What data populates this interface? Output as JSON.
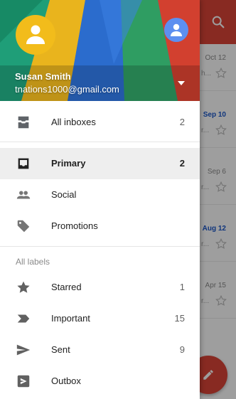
{
  "account": {
    "name": "Susan Smith",
    "email": "tnations1000@gmail.com"
  },
  "drawer": {
    "all_inboxes": {
      "label": "All inboxes",
      "count": "2"
    },
    "categories": [
      {
        "label": "Primary",
        "count": "2",
        "icon": "inbox-icon",
        "selected": true
      },
      {
        "label": "Social",
        "count": "",
        "icon": "people-icon"
      },
      {
        "label": "Promotions",
        "count": "",
        "icon": "tag-icon"
      }
    ],
    "labels_header": "All labels",
    "labels": [
      {
        "label": "Starred",
        "count": "1",
        "icon": "star-icon"
      },
      {
        "label": "Important",
        "count": "15",
        "icon": "important-icon"
      },
      {
        "label": "Sent",
        "count": "9",
        "icon": "send-icon"
      },
      {
        "label": "Outbox",
        "count": "",
        "icon": "outbox-icon"
      }
    ]
  },
  "background_list": {
    "rows": [
      {
        "date": "Oct 12",
        "unread": false,
        "snippet": "h..."
      },
      {
        "date": "Sep 10",
        "unread": true,
        "snippet": "r..."
      },
      {
        "date": "Sep 6",
        "unread": false,
        "snippet": "r..."
      },
      {
        "date": "Aug 12",
        "unread": true,
        "snippet": "r..."
      },
      {
        "date": "Apr 15",
        "unread": false,
        "snippet": "r..."
      }
    ]
  },
  "colors": {
    "toolbar": "#db4437",
    "avatar_primary": "#f2bc1b",
    "avatar_secondary": "#5d8ff0",
    "unread_date": "#1a56c8"
  }
}
